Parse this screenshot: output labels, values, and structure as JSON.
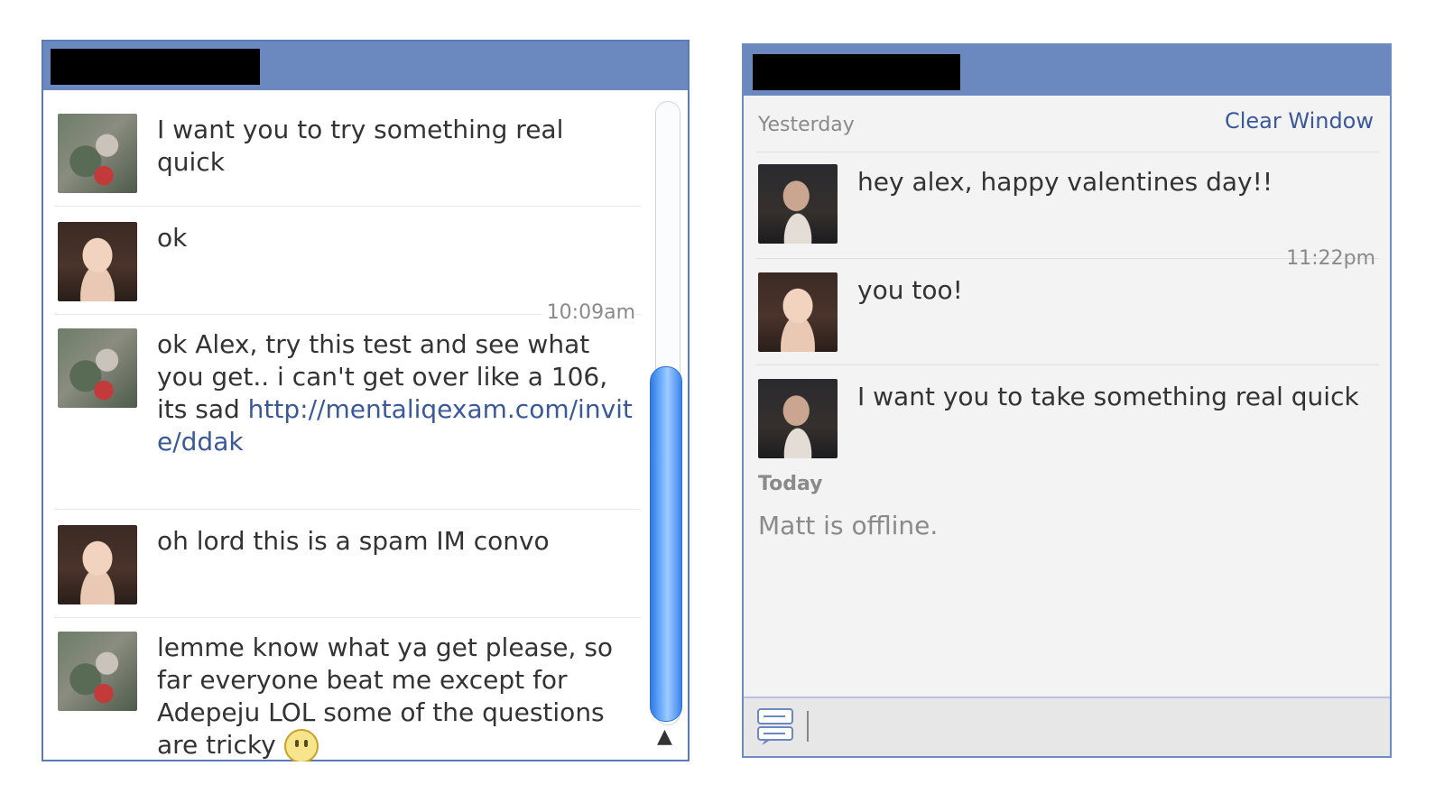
{
  "left_window": {
    "messages": [
      {
        "sender": "other",
        "text": "I want you to try something real quick"
      },
      {
        "sender": "me",
        "text": "ok"
      },
      {
        "sender": "other",
        "timestamp": "10:09am",
        "text": "ok Alex, try this test and see what you get.. i can't get over like a 106, its sad",
        "link": "http://mentaliqexam.com/invite/ddak"
      },
      {
        "sender": "me",
        "text": "oh lord this is a spam IM convo"
      },
      {
        "sender": "other",
        "text": "lemme know what ya get please, so far everyone beat me except for Adepeju LOL some of the questions are tricky"
      }
    ]
  },
  "right_window": {
    "yesterday_label": "Yesterday",
    "clear_window": "Clear Window",
    "messages": [
      {
        "sender": "other",
        "text": "hey alex, happy valentines day!!"
      },
      {
        "sender": "me",
        "timestamp": "11:22pm",
        "text": "you too!"
      },
      {
        "sender": "other",
        "text": "I want you to take something real quick"
      }
    ],
    "today_label": "Today",
    "status": "Matt is offline."
  },
  "icons": {
    "scroll_up": "▲",
    "composer": "chat-bubbles-icon",
    "emoticon": "smiley-icon"
  },
  "colors": {
    "titlebar": "#6b88bf",
    "link": "#3b5998",
    "scroll_thumb": "#3b86ec"
  }
}
